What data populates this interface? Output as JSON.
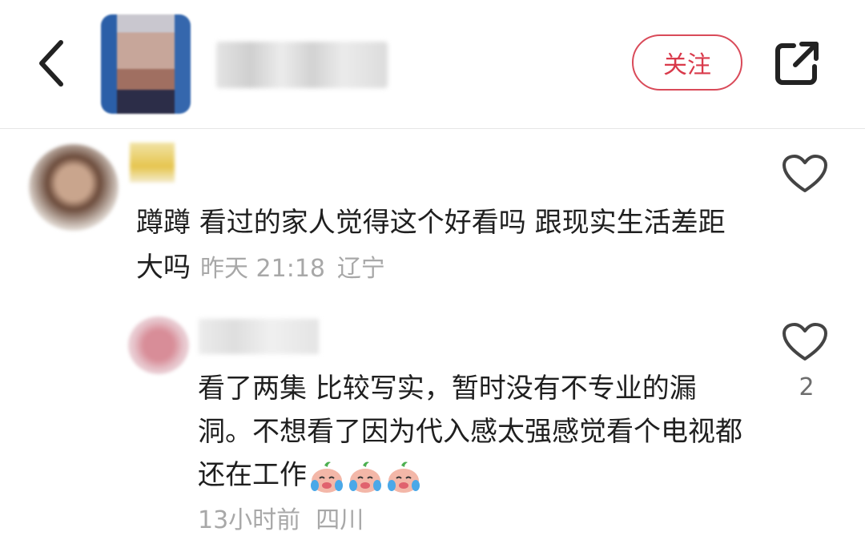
{
  "header": {
    "follow_label": "关注"
  },
  "comments": [
    {
      "text": "蹲蹲 看过的家人觉得这个好看吗 跟现实生活差距大吗",
      "time": "昨天 21:18",
      "location": "辽宁"
    },
    {
      "text": "看了两集 比较写实，暂时没有不专业的漏洞。不想看了因为代入感太强感觉看个电视都还在工作",
      "time": "13小时前",
      "location": "四川",
      "likes": "2",
      "emojis": [
        "crying-emoji",
        "crying-emoji",
        "crying-emoji"
      ]
    }
  ],
  "colors": {
    "accent": "#d93a4b",
    "meta": "#a8a8a8",
    "text": "#1f1f1f"
  }
}
